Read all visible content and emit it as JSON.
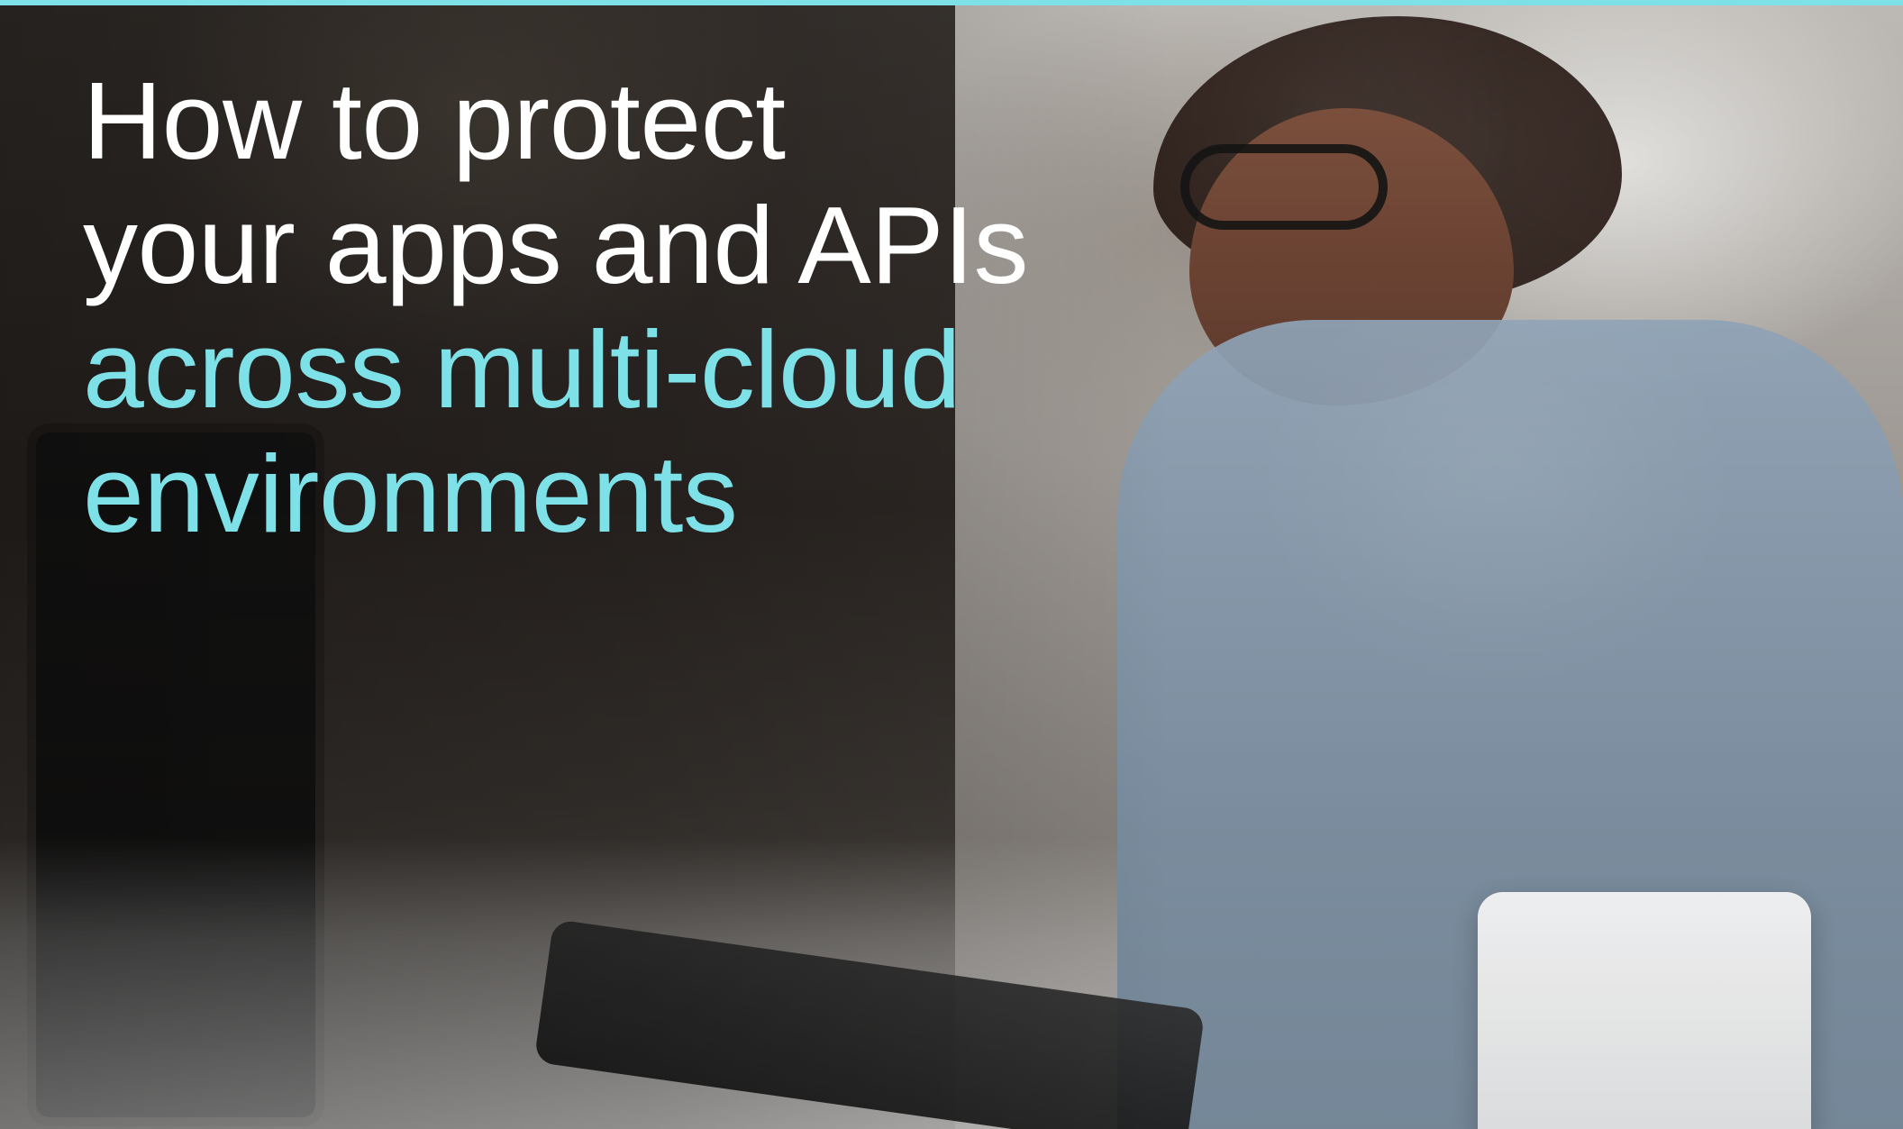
{
  "banner": {
    "headline": {
      "lines": [
        "How to protect",
        "your apps and APIs",
        "across multi-cloud",
        "environments"
      ]
    },
    "colors": {
      "accent": "#7fe1e8",
      "text_primary": "#ffffff"
    }
  }
}
